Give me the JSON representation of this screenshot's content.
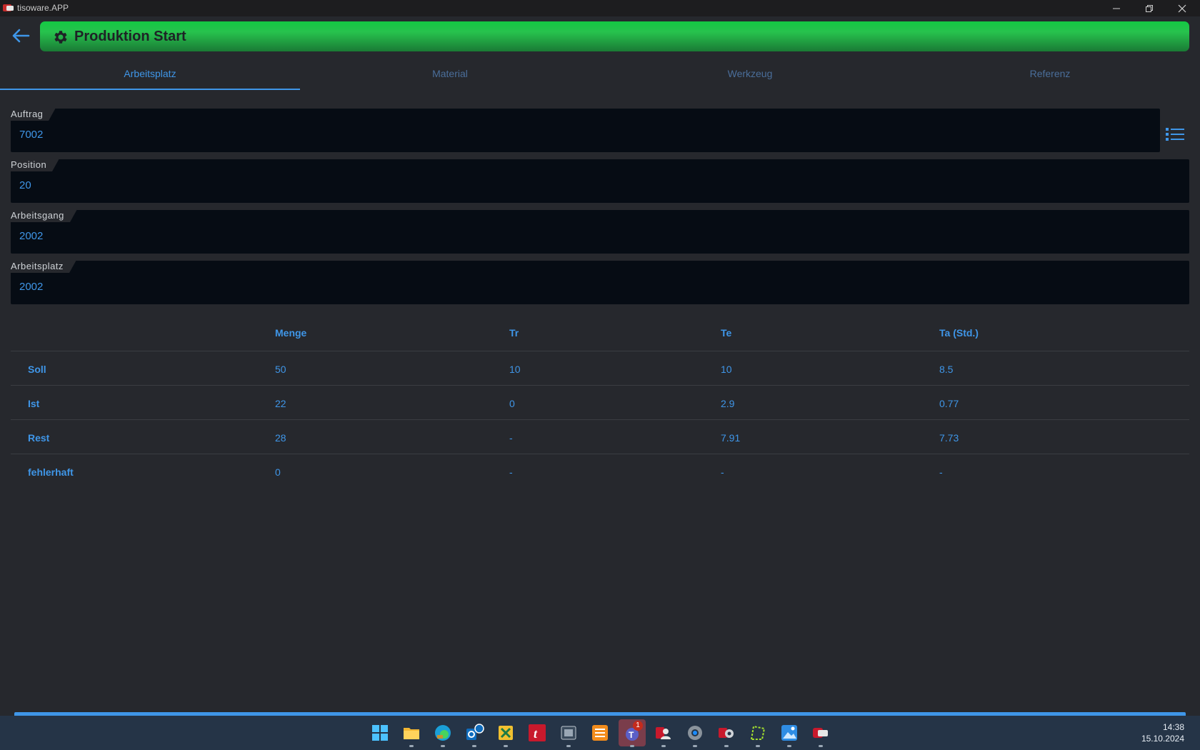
{
  "window": {
    "title": "tisoware.APP"
  },
  "header": {
    "title": "Produktion Start"
  },
  "tabs": [
    {
      "label": "Arbeitsplatz",
      "active": true
    },
    {
      "label": "Material",
      "active": false
    },
    {
      "label": "Werkzeug",
      "active": false
    },
    {
      "label": "Referenz",
      "active": false
    }
  ],
  "fields": {
    "auftrag": {
      "label": "Auftrag",
      "value": "7002"
    },
    "position": {
      "label": "Position",
      "value": "20"
    },
    "arbeitsgang": {
      "label": "Arbeitsgang",
      "value": "2002"
    },
    "arbeitsplatz": {
      "label": "Arbeitsplatz",
      "value": "2002"
    }
  },
  "table": {
    "columns": [
      "Menge",
      "Tr",
      "Te",
      "Ta (Std.)"
    ],
    "rows": [
      {
        "label": "Soll",
        "values": [
          "50",
          "10",
          "10",
          "8.5"
        ]
      },
      {
        "label": "Ist",
        "values": [
          "22",
          "0",
          "2.9",
          "0.77"
        ]
      },
      {
        "label": "Rest",
        "values": [
          "28",
          "-",
          "7.91",
          "7.73"
        ]
      },
      {
        "label": "fehlerhaft",
        "values": [
          "0",
          "-",
          "-",
          "-"
        ]
      }
    ]
  },
  "taskbar": {
    "time": "14:38",
    "date": "15.10.2024",
    "badge": "1",
    "icons": [
      "start-icon",
      "file-explorer-icon",
      "edge-icon",
      "outlook-icon",
      "excel-icon",
      "tisoware-t-icon",
      "app-icon",
      "sheets-icon",
      "teams-icon",
      "contact-icon",
      "settings-icon",
      "gear-app-icon",
      "tool-icon",
      "photos-icon",
      "tisoware-app-icon"
    ]
  },
  "colors": {
    "accent": "#3f96e8",
    "header_green": "#22c24a",
    "background": "#26282d",
    "field_bg": "#060c14"
  }
}
